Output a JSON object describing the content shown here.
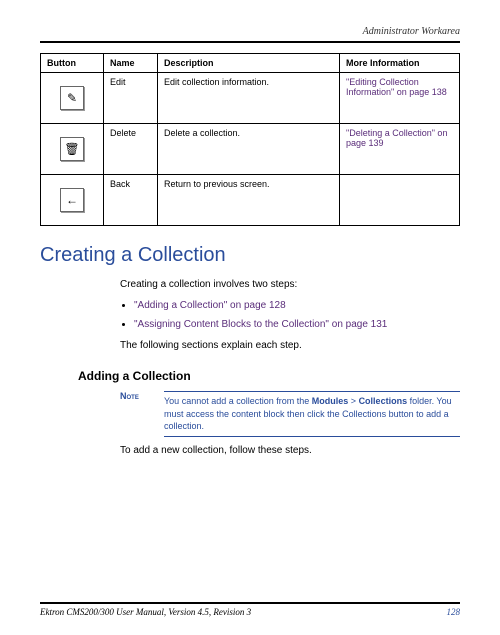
{
  "header": {
    "breadcrumb": "Administrator Workarea"
  },
  "table": {
    "headers": {
      "button": "Button",
      "name": "Name",
      "description": "Description",
      "more": "More Information"
    },
    "rows": [
      {
        "icon": "edit-icon",
        "glyph": "✎",
        "name": "Edit",
        "description": "Edit collection information.",
        "more": "\"Editing Collection Information\" on page 138"
      },
      {
        "icon": "delete-icon",
        "glyph": "🗑",
        "name": "Delete",
        "description": "Delete a collection.",
        "more": "\"Deleting a Collection\" on page 139"
      },
      {
        "icon": "back-icon",
        "glyph": "←",
        "name": "Back",
        "description": "Return to previous screen.",
        "more": ""
      }
    ]
  },
  "section": {
    "title": "Creating a Collection",
    "intro": "Creating a collection involves two steps:",
    "bullets": [
      "\"Adding a Collection\" on page 128",
      "\"Assigning Content Blocks to the Collection\" on page 131"
    ],
    "followup": "The following sections explain each step."
  },
  "subsection": {
    "title": "Adding a Collection",
    "note_label": "Note",
    "note_text_1": "You cannot add a collection from the ",
    "note_bold_1": "Modules",
    "note_sep": " > ",
    "note_bold_2": "Collections",
    "note_text_2": " folder. You must access the content block then click the Collections button to add a collection.",
    "body": "To add a new collection, follow these steps."
  },
  "footer": {
    "manual": "Ektron CMS200/300 User Manual, Version 4.5, Revision 3",
    "page": "128"
  }
}
